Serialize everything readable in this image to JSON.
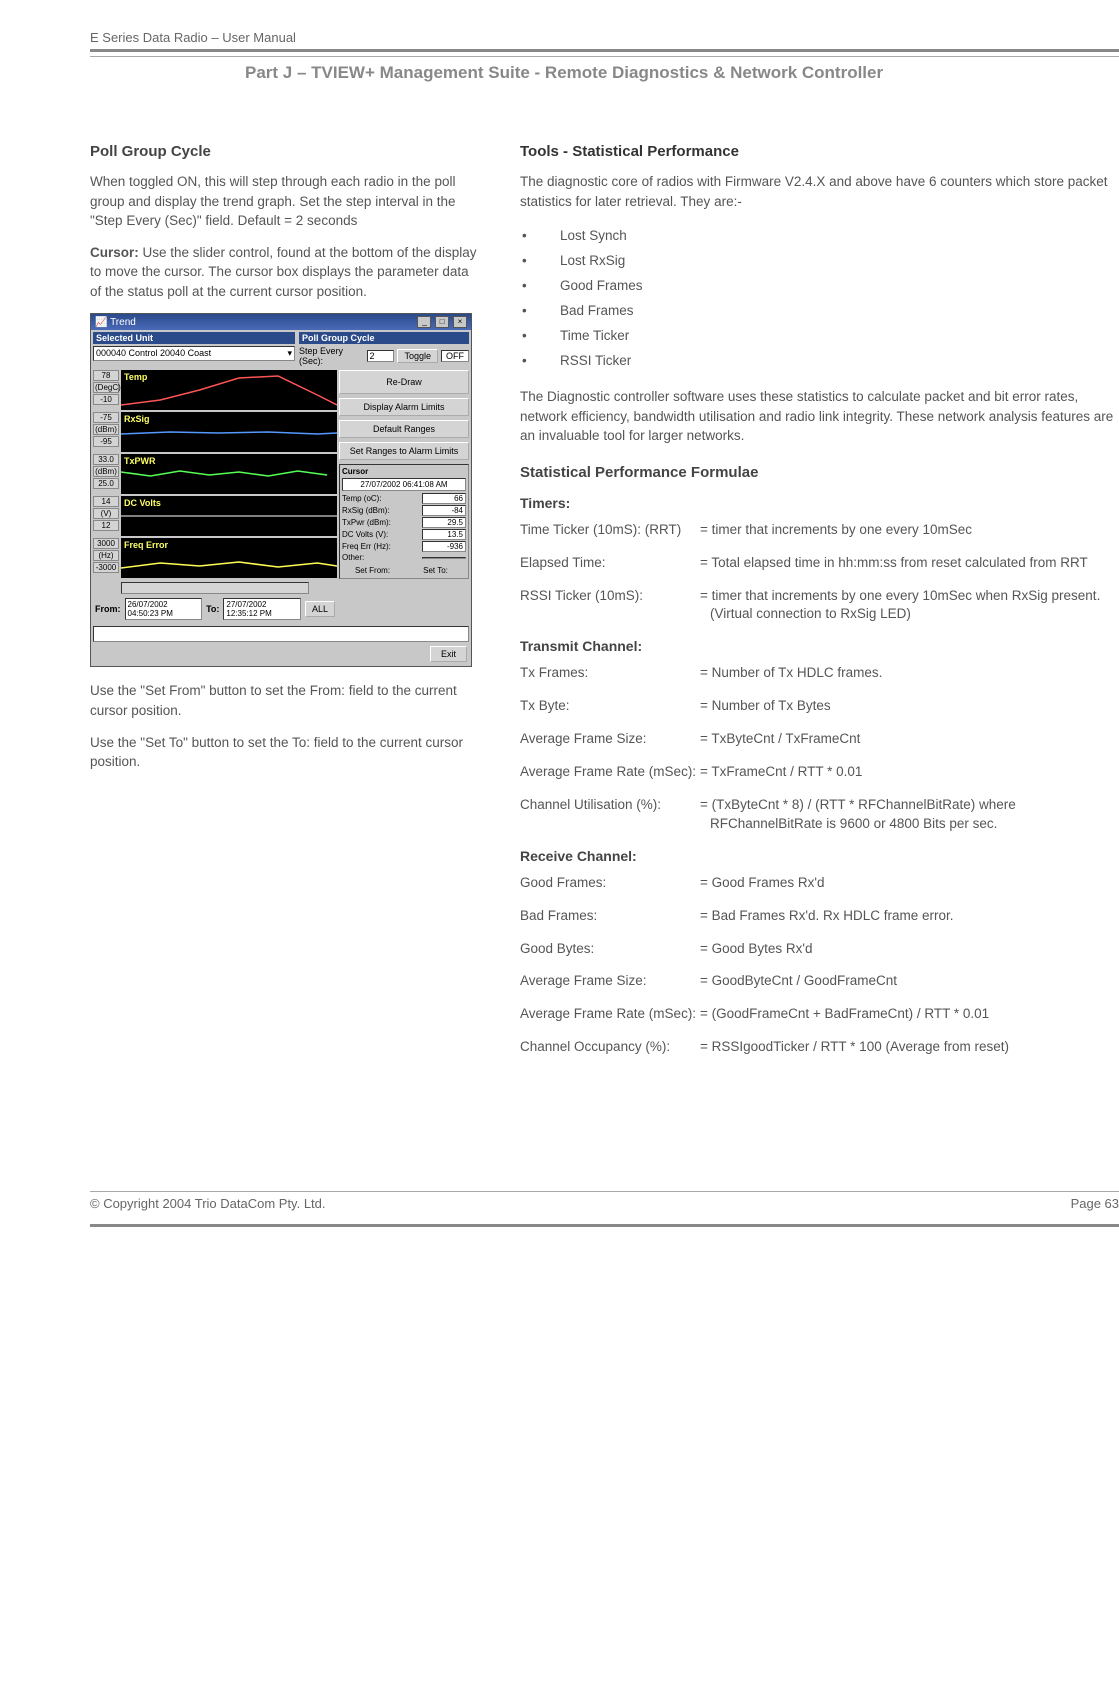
{
  "header": {
    "product_line": "E Series Data Radio – User Manual",
    "section_title": "Part J – TVIEW+ Management Suite -  Remote Diagnostics & Network Controller"
  },
  "left": {
    "h_poll": "Poll Group Cycle",
    "p_poll": "When toggled ON, this will step through each radio in the poll group and display the trend graph.  Set the step interval in the \"Step Every (Sec)\" field. Default = 2 seconds",
    "p_cursor_label": "Cursor:",
    "p_cursor": "  Use the slider control, found at the bottom of the display to move the cursor.  The cursor box displays the parameter data of the status poll at the current cursor position.",
    "p_setfrom": "Use the \"Set From\" button to set the From: field to the current cursor position.",
    "p_setto": "Use the \"Set To\" button to set the To: field to the current cursor position."
  },
  "screenshot": {
    "window_title": "Trend",
    "selected_unit_label": "Selected Unit",
    "selected_unit_value": "000040 Control 20040  Coast",
    "poll_group_label": "Poll Group Cycle",
    "step_label": "Step Every (Sec):",
    "step_value": "2",
    "toggle_btn": "Toggle",
    "toggle_state": "OFF",
    "graphs": [
      {
        "title": "Temp",
        "top": "78",
        "unit": "(DegC)",
        "bot": "-10",
        "stroke": "#ff5555"
      },
      {
        "title": "RxSig",
        "top": "-75",
        "unit": "(dBm)",
        "bot": "-95",
        "stroke": "#5599ff"
      },
      {
        "title": "TxPWR",
        "top": "33.0",
        "unit": "(dBm)",
        "bot": "25.0",
        "stroke": "#55ff55"
      },
      {
        "title": "DC Volts",
        "top": "14",
        "unit": "(V)",
        "bot": "12",
        "stroke": "#aaaaaa"
      },
      {
        "title": "Freq Error",
        "top": "3000",
        "unit": "(Hz)",
        "bot": "-3000",
        "stroke": "#ffff55"
      }
    ],
    "side_buttons": {
      "redraw": "Re-Draw",
      "alarm_limits": "Display Alarm Limits",
      "default_ranges": "Default Ranges",
      "set_ranges": "Set Ranges to Alarm Limits"
    },
    "cursor": {
      "title": "Cursor",
      "date": "27/07/2002 06:41:08 AM",
      "rows": [
        {
          "label": "Temp (oC):",
          "value": "66"
        },
        {
          "label": "RxSig (dBm):",
          "value": "-84"
        },
        {
          "label": "TxPwr (dBm):",
          "value": "29.5"
        },
        {
          "label": "DC Volts (V):",
          "value": "13.5"
        },
        {
          "label": "Freq Err (Hz):",
          "value": "-936"
        },
        {
          "label": "Other:",
          "value": ""
        }
      ],
      "set_from_btn": "Set From:",
      "set_to_btn": "Set To:"
    },
    "bottom": {
      "from_label": "From:",
      "from_value": "26/07/2002 04:50:23 PM",
      "to_label": "To:",
      "to_value": "27/07/2002 12:35:12 PM",
      "all_btn": "ALL"
    },
    "exit_btn": "Exit"
  },
  "right": {
    "h_tools": "Tools - Statistical Performance",
    "p_intro": "The diagnostic core of radios with Firmware V2.4.X and above have 6 counters which store packet statistics for later retrieval.  They are:-",
    "counters": [
      "Lost Synch",
      "Lost RxSig",
      "Good Frames",
      "Bad Frames",
      "Time Ticker",
      "RSSI Ticker"
    ],
    "p_diag": "The Diagnostic controller software uses these statistics to calculate packet and bit error rates, network efficiency, bandwidth utilisation and radio link integrity.  These network analysis features are an invaluable tool for larger networks.",
    "h_formulae": "Statistical Performance Formulae",
    "groups": {
      "timers_label": "Timers:",
      "timers": [
        {
          "term": "Time Ticker (10mS): (RRT)",
          "desc": "= timer that increments by one every 10mSec"
        },
        {
          "term": "Elapsed Time:",
          "desc": "= Total elapsed time in hh:mm:ss from reset calculated from RRT"
        },
        {
          "term": "RSSI Ticker (10mS):",
          "desc": "=  timer that increments by one every 10mSec when RxSig present. (Virtual connection to RxSig LED)"
        }
      ],
      "tx_label": "Transmit Channel:",
      "tx": [
        {
          "term": "Tx Frames:",
          "desc": "= Number of Tx HDLC frames."
        },
        {
          "term": "Tx  Byte:",
          "desc": "= Number of Tx Bytes"
        },
        {
          "term": "Average Frame Size:",
          "desc": "= TxByteCnt / TxFrameCnt"
        },
        {
          "term": "Average Frame Rate (mSec):",
          "desc": "= TxFrameCnt / RTT * 0.01"
        },
        {
          "term": "Channel Utilisation (%):",
          "desc": "= (TxByteCnt * 8) / (RTT * RFChannelBitRate) where RFChannelBitRate is 9600 or 4800 Bits per sec."
        }
      ],
      "rx_label": "Receive Channel:",
      "rx": [
        {
          "term": "Good Frames:",
          "desc": "= Good Frames Rx'd"
        },
        {
          "term": "Bad Frames:",
          "desc": "= Bad Frames Rx'd. Rx HDLC frame error."
        },
        {
          "term": "Good Bytes:",
          "desc": "= Good Bytes Rx'd"
        },
        {
          "term": "Average Frame Size:",
          "desc": "= GoodByteCnt / GoodFrameCnt"
        },
        {
          "term": "Average Frame Rate (mSec):",
          "desc": "= (GoodFrameCnt + BadFrameCnt) / RTT * 0.01"
        },
        {
          "term": "Channel Occupancy (%):",
          "desc": "= RSSIgoodTicker / RTT * 100 (Average from reset)"
        }
      ]
    }
  },
  "footer": {
    "copyright": "© Copyright 2004 Trio DataCom Pty. Ltd.",
    "page": "Page 63"
  }
}
